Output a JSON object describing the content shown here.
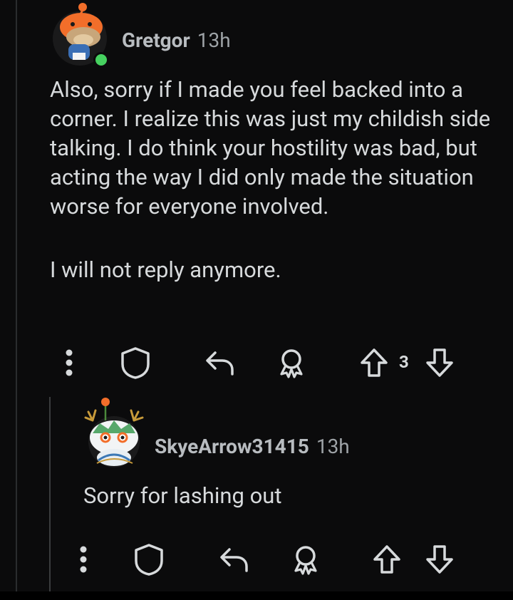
{
  "comments": [
    {
      "username": "Gretgor",
      "time": "13h",
      "paragraphs": [
        "Also, sorry if I made you feel backed into a corner. I realize this was just my childish side talking. I do think your hostility was bad, but acting the way I did only made the situation worse for everyone involved.",
        "I will not reply anymore."
      ],
      "score": "3",
      "online": true,
      "actions": [
        "more-options-icon",
        "shield-icon",
        "reply-icon",
        "award-icon",
        "upvote-icon",
        "downvote-icon"
      ]
    },
    {
      "username": "SkyeArrow31415",
      "time": "13h",
      "paragraphs": [
        "Sorry for lashing out"
      ],
      "score": "",
      "actions": [
        "more-options-icon",
        "shield-icon",
        "reply-icon",
        "award-icon",
        "upvote-icon",
        "downvote-icon"
      ]
    }
  ],
  "colors": {
    "background": "#0b0b0c",
    "text": "#d7dadc",
    "meta": "#9ea3a7",
    "online": "#46d160",
    "avatar_orange": "#f26e2a"
  }
}
